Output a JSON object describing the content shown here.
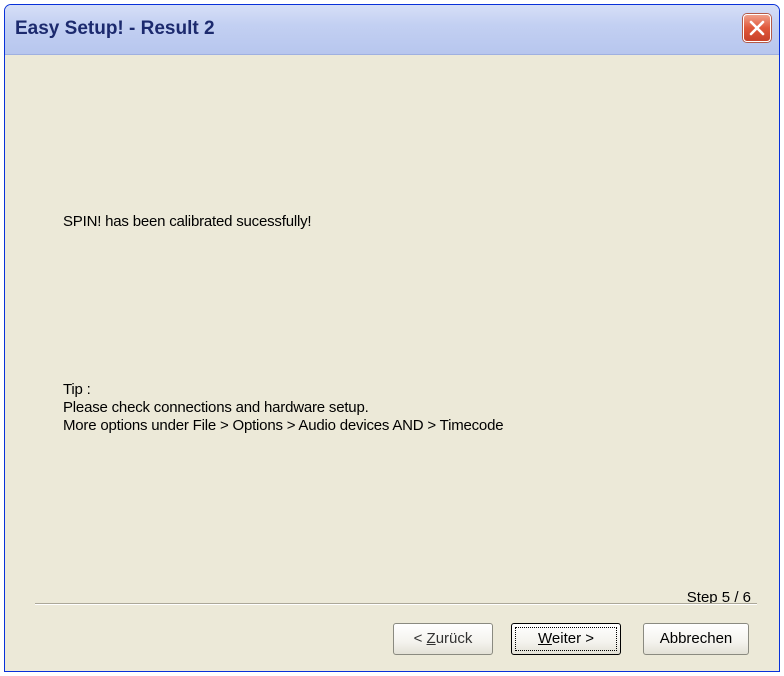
{
  "window": {
    "title": "Easy Setup! - Result 2"
  },
  "content": {
    "message": "SPIN! has been calibrated sucessfully!",
    "tip_heading": "Tip :",
    "tip_line_1": "Please check connections and hardware setup.",
    "tip_line_2": "More options under File > Options > Audio devices AND > Timecode",
    "step": "Step 5 / 6"
  },
  "buttons": {
    "back_prefix": "< ",
    "back_accel": "Z",
    "back_rest": "urück",
    "next_accel": "W",
    "next_rest": "eiter >",
    "cancel": "Abbrechen"
  },
  "icons": {
    "close": "close-icon"
  },
  "colors": {
    "titlebar": "#c3d0f2",
    "close_button": "#e0583a",
    "dialog_background": "#ece9d8"
  }
}
